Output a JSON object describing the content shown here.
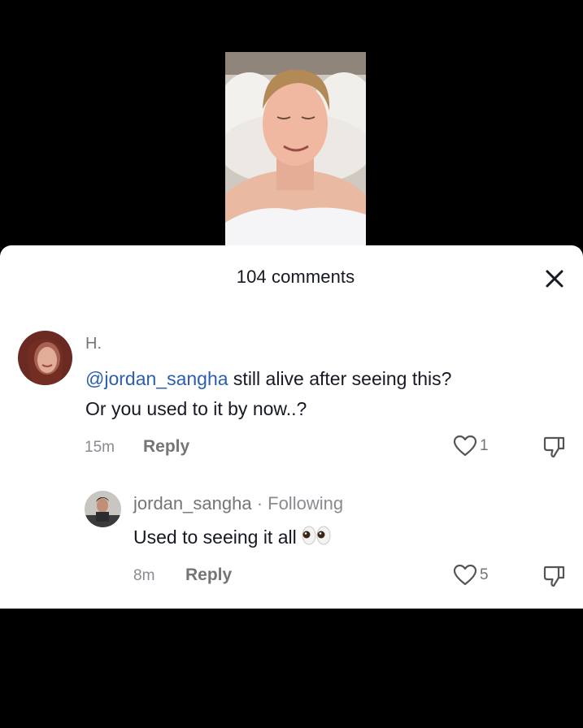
{
  "video": {
    "thumbnail_icon": "video-thumbnail"
  },
  "comments_sheet": {
    "title": "104 comments",
    "close_icon": "close-icon",
    "comments": [
      {
        "author": "H.",
        "mention": "@jordan_sangha",
        "text_line1": " still alive after seeing this?",
        "text_line2": "Or you used to it by now..?",
        "time": "15m",
        "reply_label": "Reply",
        "likes": "1"
      },
      {
        "author": "jordan_sangha",
        "author_suffix": " · Following",
        "text": "Used to seeing it all",
        "emoji": "eyes-emoji",
        "time": "8m",
        "reply_label": "Reply",
        "likes": "5"
      }
    ]
  },
  "colors": {
    "mention": "#2b5db0",
    "text": "#161823",
    "secondary": "#757575",
    "background": "#000000",
    "sheet": "#ffffff"
  }
}
